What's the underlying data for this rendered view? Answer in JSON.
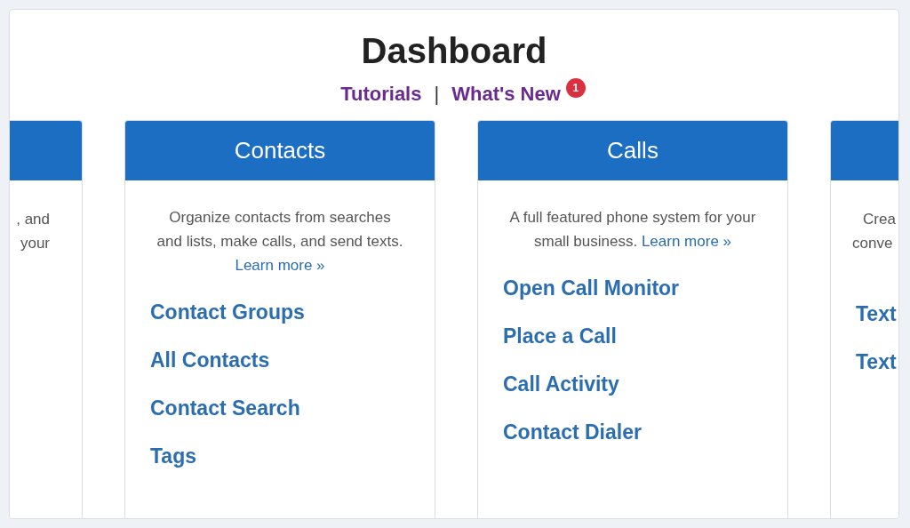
{
  "title": "Dashboard",
  "nav_links": [
    {
      "label": "Tutorials"
    },
    {
      "label": "What's New",
      "badge": "1"
    }
  ],
  "separator": "|",
  "cards": [
    {
      "kind": "cut-left",
      "description_lines": [
        ", and",
        "your"
      ]
    },
    {
      "kind": "full",
      "title": "Contacts",
      "description": "Organize contacts from searches and lists, make calls, and send texts.",
      "learn_more": "Learn more »",
      "links": [
        "Contact Groups",
        "All Contacts",
        "Contact Search",
        "Tags"
      ]
    },
    {
      "kind": "full",
      "title": "Calls",
      "description": "A full featured phone system for your small business.",
      "learn_more": "Learn more »",
      "links": [
        "Open Call Monitor",
        "Place a Call",
        "Call Activity",
        "Contact Dialer"
      ]
    },
    {
      "kind": "cut-right",
      "description_lines": [
        "Crea",
        "conve"
      ],
      "links": [
        "Text",
        "Text"
      ]
    }
  ]
}
